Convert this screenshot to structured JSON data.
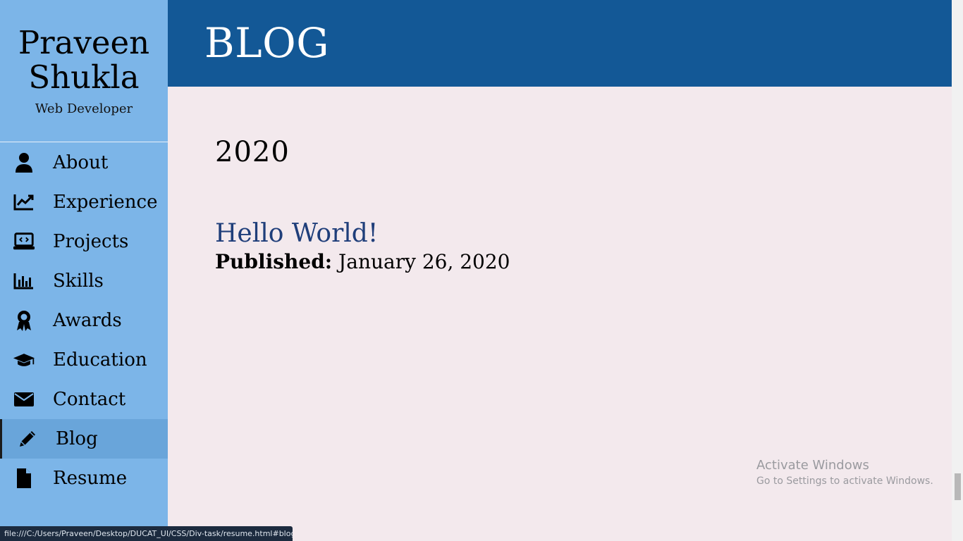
{
  "sidebar": {
    "name_line1": "Praveen",
    "name_line2": "Shukla",
    "role": "Web Developer",
    "items": [
      {
        "label": "About",
        "icon": "user-icon"
      },
      {
        "label": "Experience",
        "icon": "chart-line-icon"
      },
      {
        "label": "Projects",
        "icon": "laptop-code-icon"
      },
      {
        "label": "Skills",
        "icon": "bar-chart-icon"
      },
      {
        "label": "Awards",
        "icon": "award-icon"
      },
      {
        "label": "Education",
        "icon": "graduation-cap-icon"
      },
      {
        "label": "Contact",
        "icon": "envelope-icon"
      },
      {
        "label": "Blog",
        "icon": "pencil-icon",
        "active": true
      },
      {
        "label": "Resume",
        "icon": "file-icon"
      }
    ]
  },
  "header": {
    "title": "BLOG"
  },
  "main": {
    "year": "2020",
    "post": {
      "title": "Hello World!",
      "published_label": "Published:",
      "published_date": "January 26, 2020"
    }
  },
  "watermark": {
    "line1": "Activate Windows",
    "line2": "Go to Settings to activate Windows."
  },
  "status_bar": {
    "url": "file:///C:/Users/Praveen/Desktop/DUCAT_UI/CSS/Div-task/resume.html#blog"
  },
  "colors": {
    "sidebar_bg": "#7cb5e8",
    "header_bg": "#135896",
    "page_bg": "#f3e9ed",
    "link": "#1f3e7a"
  }
}
